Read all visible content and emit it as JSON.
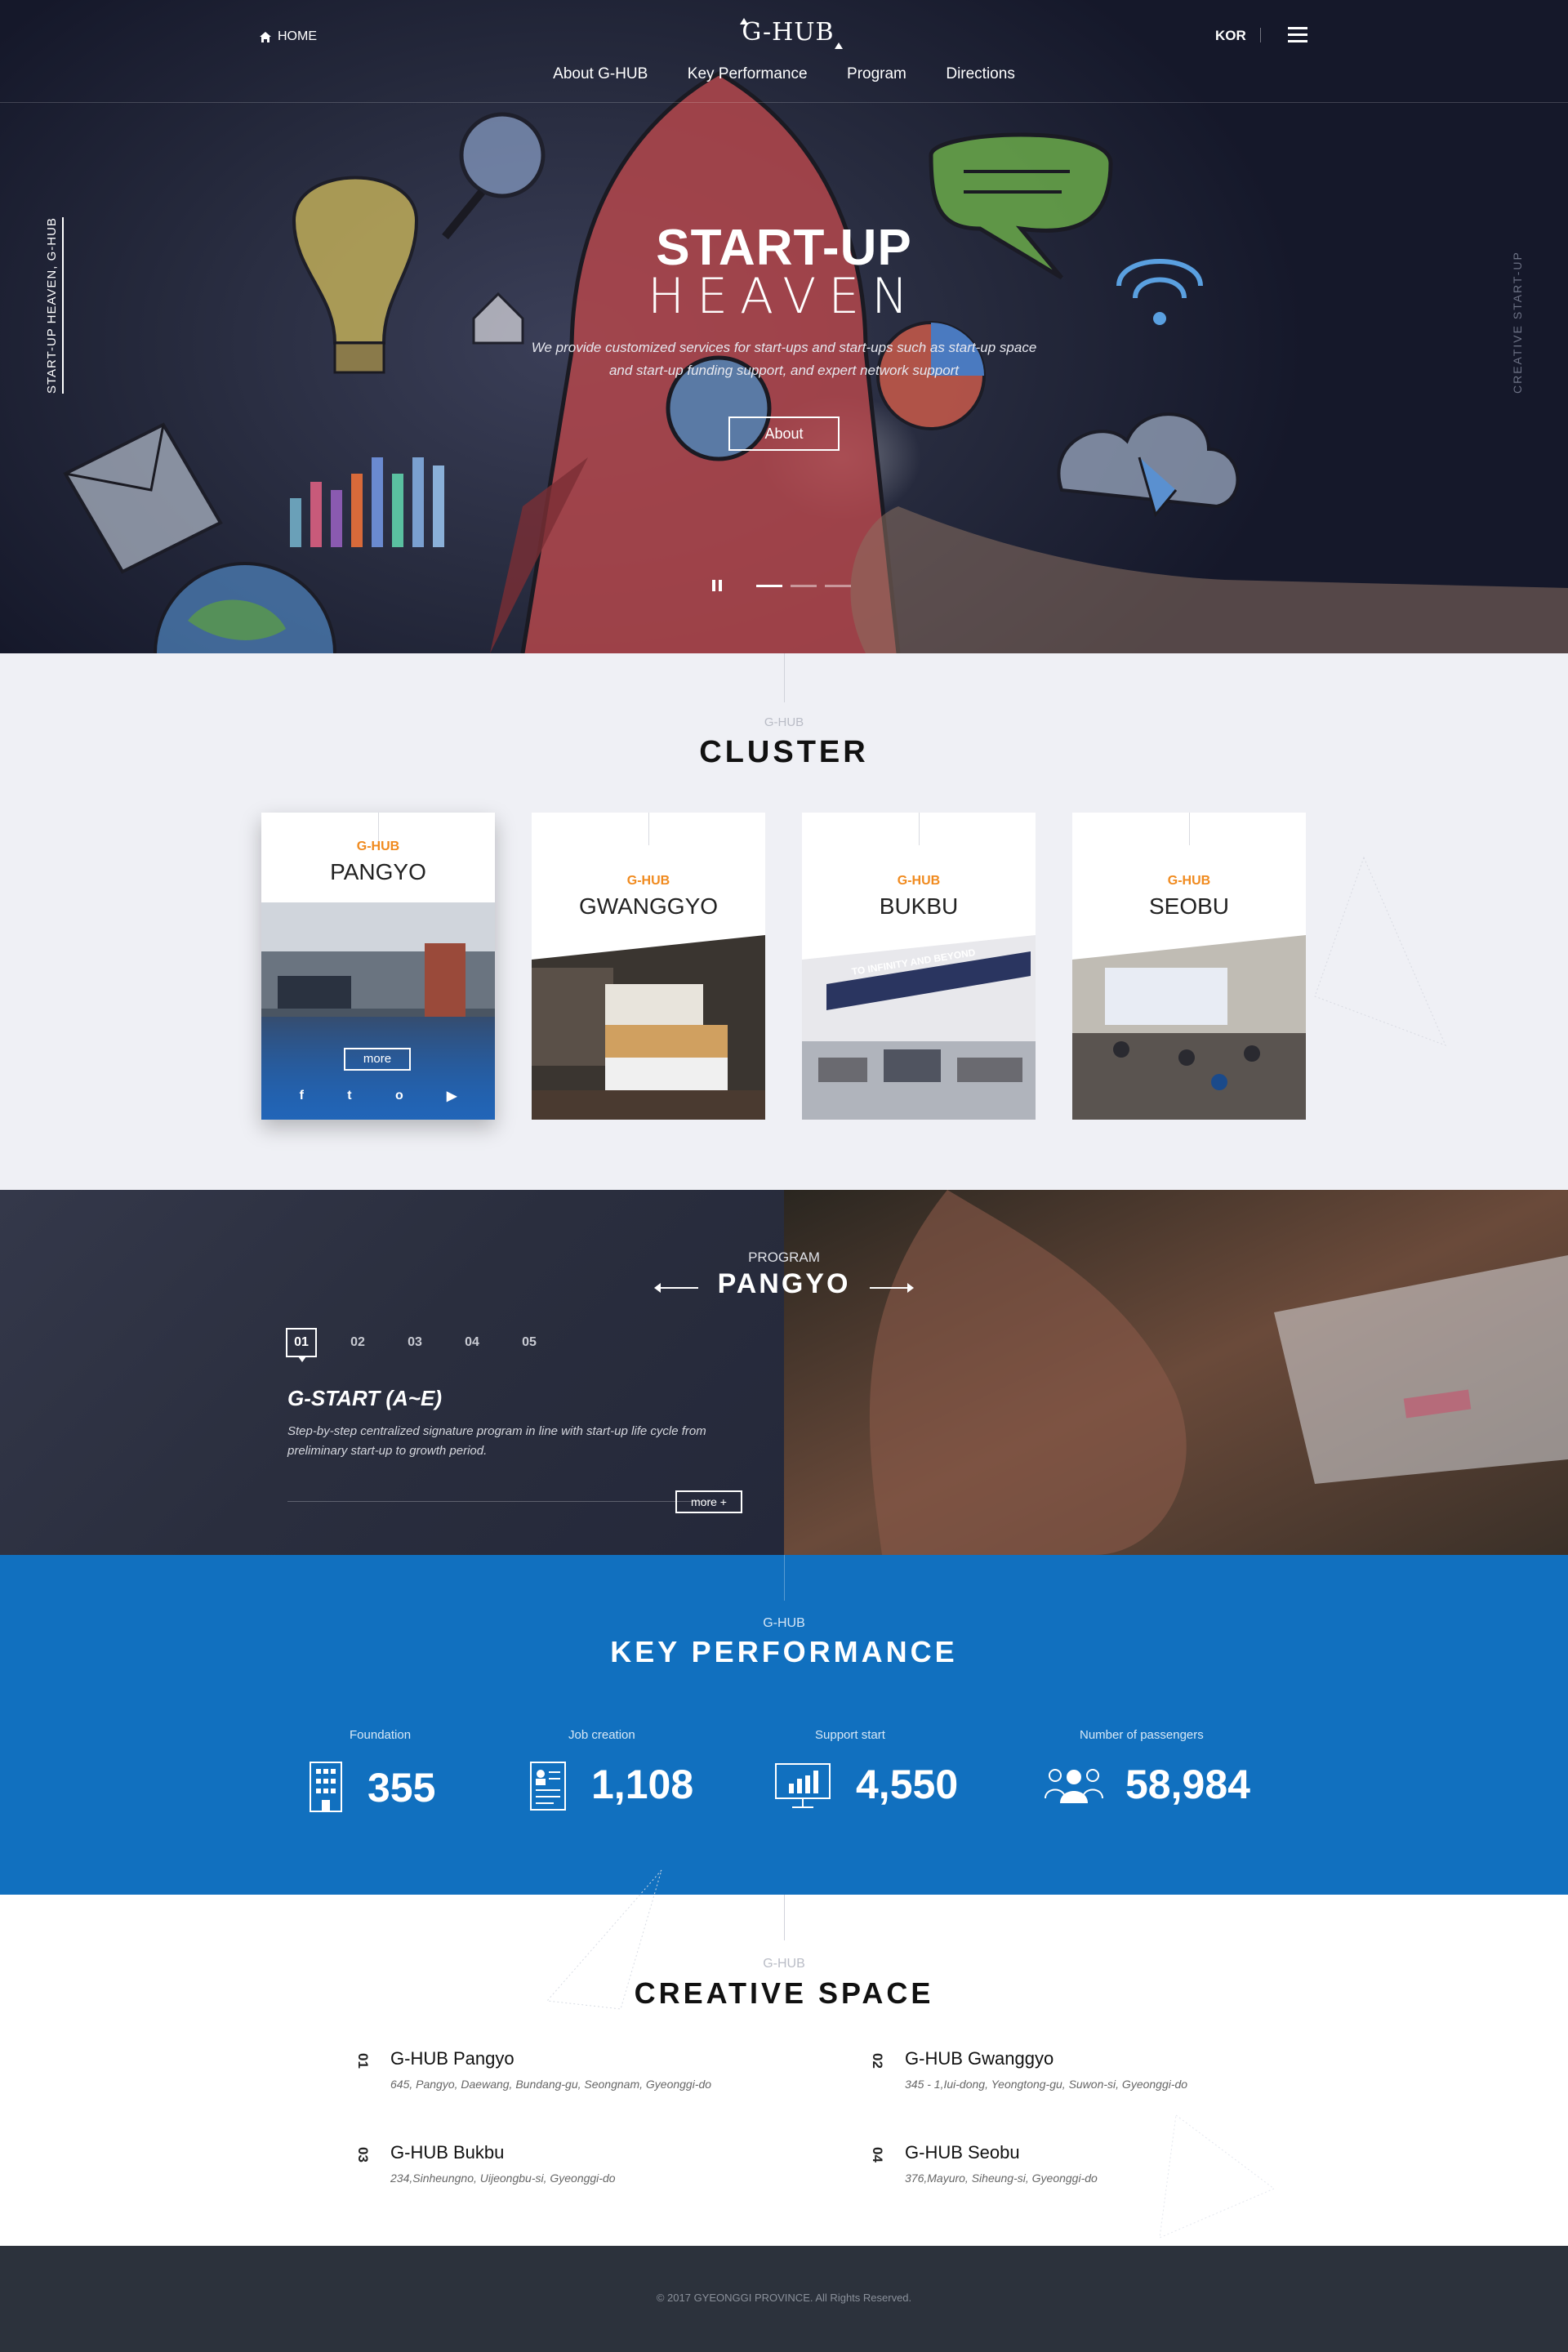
{
  "header": {
    "home_label": "HOME",
    "logo": "G-HUB",
    "lang": "KOR",
    "nav": [
      "About G-HUB",
      "Key Performance",
      "Program",
      "Directions"
    ]
  },
  "hero": {
    "side_left": "START-UP HEAVEN, G-HUB",
    "side_right": "CREATIVE  START-UP",
    "title_line1": "START-UP",
    "title_line2": "HEAVEN",
    "desc_line1": "We provide customized services for start-ups and start-ups such as start-up space",
    "desc_line2": "and start-up funding support, and expert network support",
    "button": "About",
    "slide_count": 3,
    "active_slide": 1
  },
  "cluster": {
    "sub": "G-HUB",
    "title": "CLUSTER",
    "cards": [
      {
        "sub": "G-HUB",
        "name": "PANGYO"
      },
      {
        "sub": "G-HUB",
        "name": "GWANGGYO"
      },
      {
        "sub": "G-HUB",
        "name": "BUKBU"
      },
      {
        "sub": "G-HUB",
        "name": "SEOBU"
      }
    ],
    "more": "more",
    "banner_text": "TO INFINITY AND BEYOND",
    "social": [
      "f",
      "t",
      "o",
      "▶"
    ]
  },
  "program": {
    "sub": "PROGRAM",
    "title": "PANGYO",
    "tabs": [
      "01",
      "02",
      "03",
      "04",
      "05"
    ],
    "name": "G-START (A~E)",
    "desc_line1": "Step-by-step centralized signature program in line with start-up life cycle from",
    "desc_line2": "preliminary start-up to growth period.",
    "more": "more  +"
  },
  "key_performance": {
    "sub": "G-HUB",
    "title": "KEY PERFORMANCE",
    "stats": [
      {
        "label": "Foundation",
        "value": "355",
        "icon": "building-icon"
      },
      {
        "label": "Job creation",
        "value": "1,108",
        "icon": "document-icon"
      },
      {
        "label": "Support start",
        "value": "4,550",
        "icon": "monitor-chart-icon"
      },
      {
        "label": "Number of passengers",
        "value": "58,984",
        "icon": "people-icon"
      }
    ]
  },
  "creative_space": {
    "sub": "G-HUB",
    "title": "CREATIVE SPACE",
    "locations": [
      {
        "num": "01",
        "name": "G-HUB Pangyo",
        "address": "645, Pangyo, Daewang, Bundang-gu, Seongnam, Gyeonggi-do"
      },
      {
        "num": "02",
        "name": "G-HUB Gwanggyo",
        "address": "345 - 1,Iui-dong, Yeongtong-gu, Suwon-si, Gyeonggi-do"
      },
      {
        "num": "03",
        "name": "G-HUB Bukbu",
        "address": "234,Sinheungno, Uijeongbu-si, Gyeonggi-do"
      },
      {
        "num": "04",
        "name": "G-HUB Seobu",
        "address": "376,Mayuro, Siheung-si, Gyeonggi-do"
      }
    ]
  },
  "footer": {
    "copyright": "© 2017 GYEONGGI PROVINCE. All Rights Reserved."
  },
  "colors": {
    "accent_blue": "#1170bf",
    "accent_orange": "#f08a1e",
    "footer": "#2c323c"
  }
}
